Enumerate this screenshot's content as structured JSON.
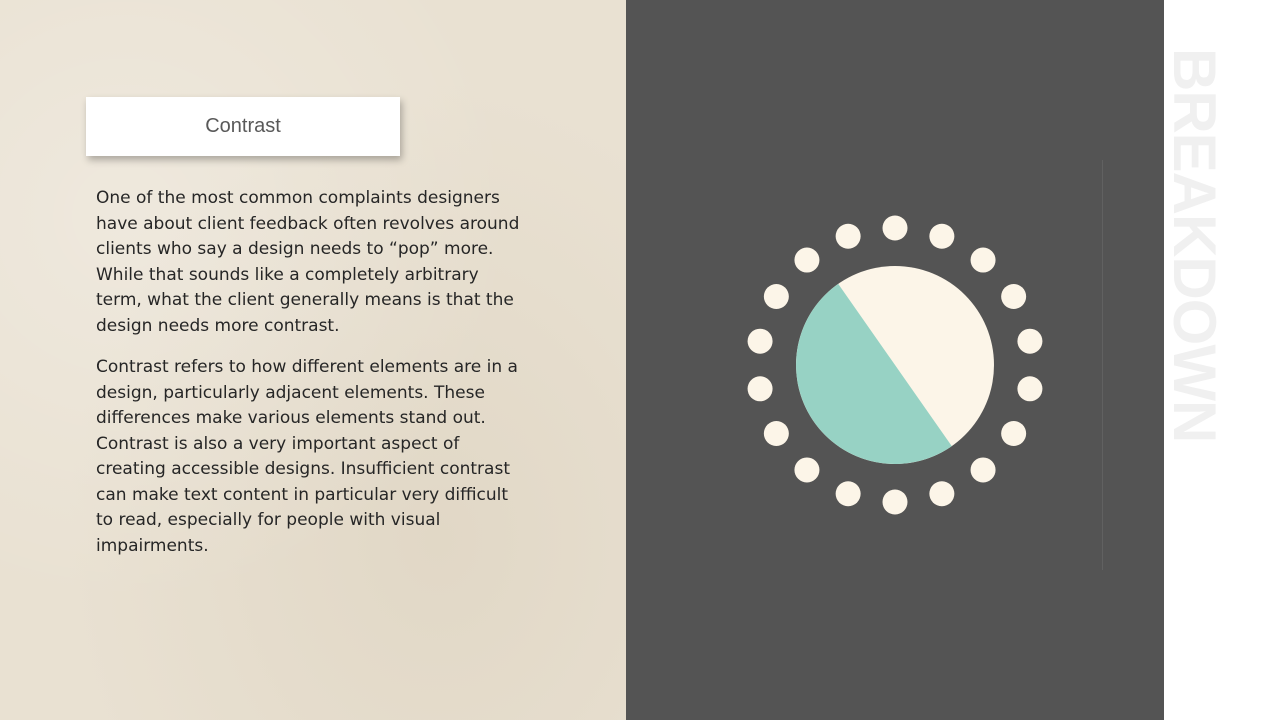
{
  "slide": {
    "title": "Contrast",
    "paragraphs": [
      "One of the most common complaints designers have about client feedback often revolves around clients who say a design needs to “pop” more. While that sounds like a completely arbitrary term, what the client generally means is that the design needs more contrast.",
      "Contrast refers to how different elements are in a design, particularly adjacent elements. These differences make various elements stand out. Contrast is also a very important aspect of creating accessible designs. Insufficient contrast can make text content in particular very difficult to read, especially for people with visual impairments."
    ],
    "side_word": "BREAKDOWN"
  },
  "colors": {
    "left_background": "#e9e1d2",
    "right_background": "#545454",
    "circle_light": "#fcf5e8",
    "circle_accent": "#97d2c4",
    "side_word": "#f0f0f0"
  },
  "icons": {
    "graphic": "contrast-circle-icon"
  }
}
